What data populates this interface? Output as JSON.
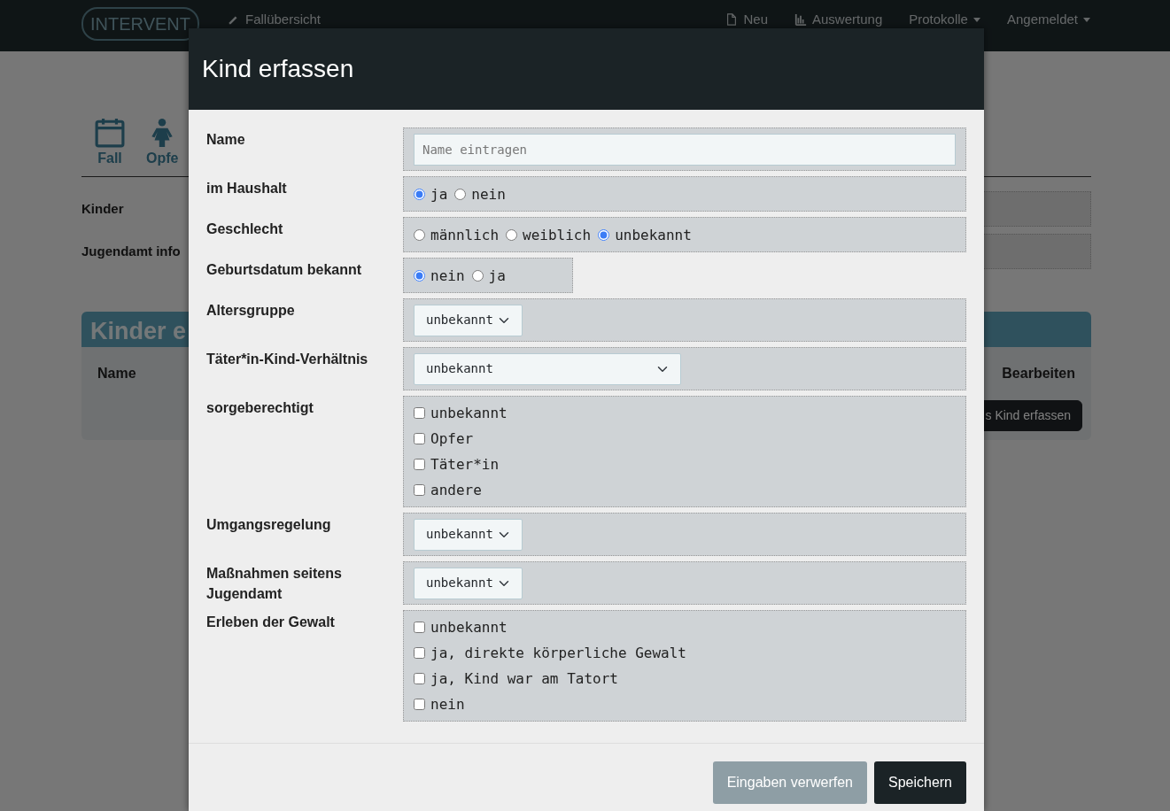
{
  "navbar": {
    "logo": "INTERVENT",
    "links": [
      {
        "label": "Fallübersicht",
        "dropdown": false
      },
      {
        "label": "Neu",
        "dropdown": false
      },
      {
        "label": "Auswertung",
        "dropdown": false
      },
      {
        "label": "Protokolle",
        "dropdown": true
      },
      {
        "label": "Angemeldet",
        "dropdown": true
      }
    ]
  },
  "background": {
    "tabs": [
      {
        "label": "Fall"
      },
      {
        "label": "Opfe"
      }
    ],
    "fields": [
      "Kinder",
      "Jugendamt info"
    ],
    "panel": {
      "title": "Kinder e",
      "columns": [
        "Name",
        "Bearbeiten"
      ],
      "button": "s Kind erfassen"
    }
  },
  "modal": {
    "title": "Kind erfassen",
    "fields": [
      {
        "kind": "text",
        "label": "Name",
        "placeholder": "Name eintragen"
      },
      {
        "kind": "radio",
        "label": "im Haushalt",
        "options": [
          {
            "label": "ja",
            "selected": true
          },
          {
            "label": "nein",
            "selected": false
          }
        ]
      },
      {
        "kind": "radio",
        "label": "Geschlecht",
        "options": [
          {
            "label": "männlich",
            "selected": false
          },
          {
            "label": "weiblich",
            "selected": false
          },
          {
            "label": "unbekannt",
            "selected": true
          }
        ]
      },
      {
        "kind": "radio",
        "label": "Geburtsdatum bekannt",
        "options": [
          {
            "label": "nein",
            "selected": true
          },
          {
            "label": "ja",
            "selected": false
          }
        ]
      },
      {
        "kind": "select",
        "label": "Altersgruppe",
        "value": "unbekannt"
      },
      {
        "kind": "select",
        "label": "Täter*in-Kind-Verhältnis",
        "value": "unbekannt"
      },
      {
        "kind": "checkbox",
        "label": "sorgeberechtigt",
        "options": [
          {
            "label": "unbekannt",
            "checked": false
          },
          {
            "label": "Opfer",
            "checked": false
          },
          {
            "label": "Täter*in",
            "checked": false
          },
          {
            "label": "andere",
            "checked": false
          }
        ]
      },
      {
        "kind": "select",
        "label": "Umgangsregelung",
        "value": "unbekannt"
      },
      {
        "kind": "select",
        "label": "Maßnahmen seitens Jugendamt",
        "value": "unbekannt"
      },
      {
        "kind": "checkbox",
        "label": "Erleben der Gewalt",
        "options": [
          {
            "label": "unbekannt",
            "checked": false
          },
          {
            "label": "ja, direkte körperliche Gewalt",
            "checked": false
          },
          {
            "label": "ja, Kind war am Tatort",
            "checked": false
          },
          {
            "label": "nein",
            "checked": false
          }
        ]
      }
    ],
    "buttons": [
      {
        "label": "Eingaben verwerfen",
        "kind": "secondary"
      },
      {
        "label": "Speichern",
        "kind": "primary"
      }
    ]
  }
}
